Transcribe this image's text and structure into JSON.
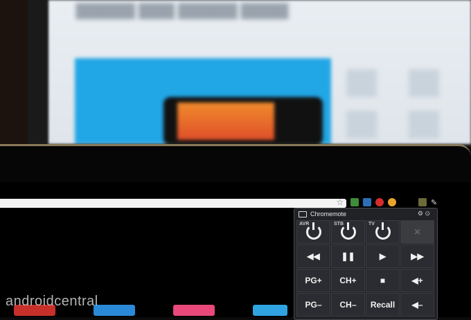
{
  "remote": {
    "title": "Chromemote",
    "tools_icon": "settings-icon",
    "power_buttons": [
      {
        "label": "AVR"
      },
      {
        "label": "STB"
      },
      {
        "label": "TV"
      }
    ],
    "transport": [
      "◀◀",
      "❚❚",
      "▶",
      "▶▶"
    ],
    "row3": [
      "PG+",
      "CH+",
      "■",
      "◀+"
    ],
    "row4": [
      "PG–",
      "CH–",
      "Recall",
      "◀–"
    ]
  },
  "watermark": "androidcentral",
  "colors": {
    "hero": "#21a6e6",
    "frame_accent": "#8a7a5a",
    "remote_bg": "#202226"
  }
}
